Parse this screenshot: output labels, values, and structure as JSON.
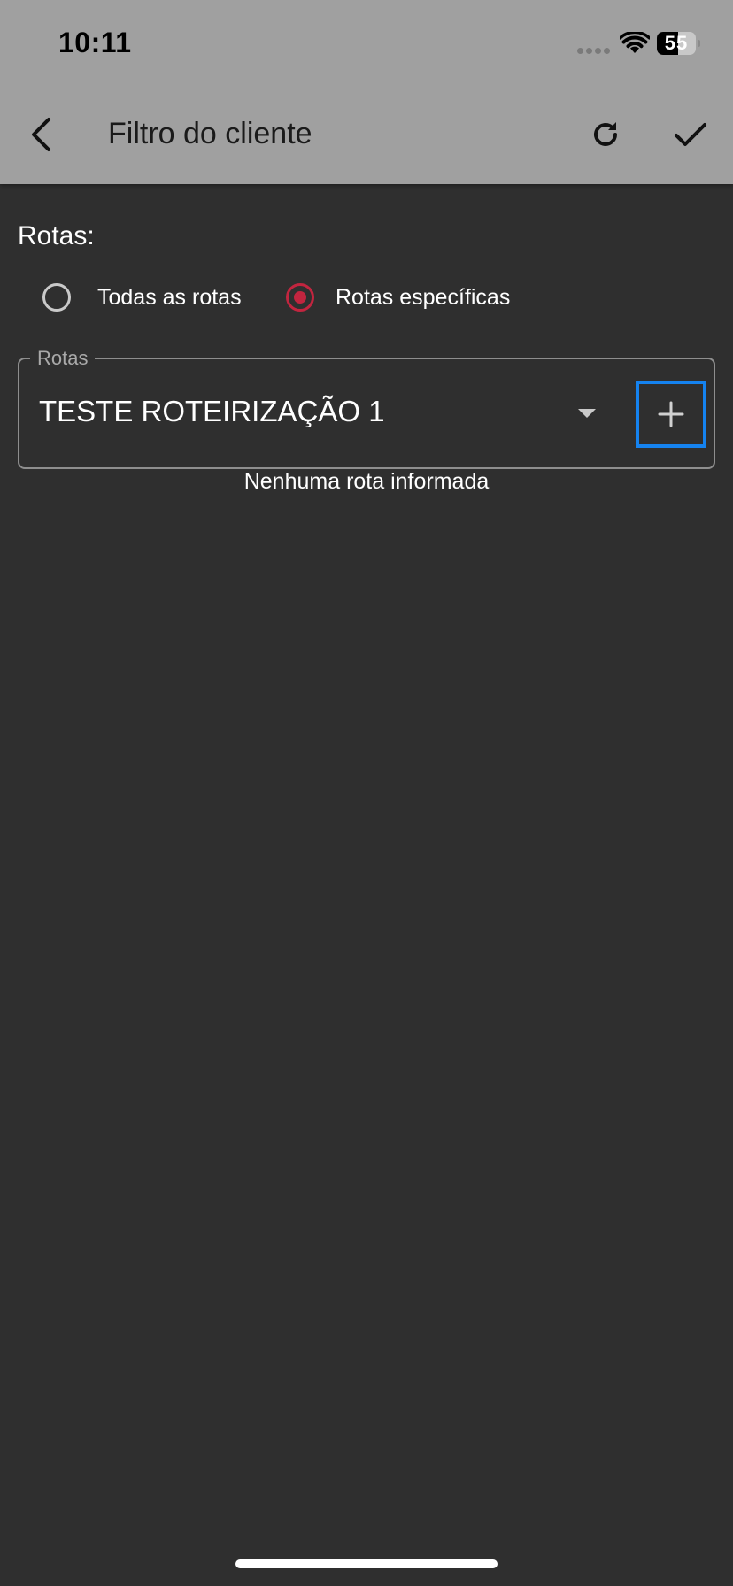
{
  "status_bar": {
    "time": "10:11",
    "battery_level": "55",
    "battery_fraction": 0.55
  },
  "app_bar": {
    "title": "Filtro do cliente",
    "back_icon": "chevron-left-icon",
    "refresh_icon": "refresh-icon",
    "confirm_icon": "check-icon"
  },
  "routes_section": {
    "label": "Rotas:",
    "options": [
      {
        "label": "Todas as rotas",
        "selected": false
      },
      {
        "label": "Rotas específicas",
        "selected": true
      }
    ]
  },
  "route_field": {
    "legend": "Rotas",
    "value": "TESTE ROTEIRIZAÇÃO 1",
    "dropdown_icon": "caret-down-icon",
    "add_icon": "plus-icon",
    "helper_text": "Nenhuma rota informada"
  },
  "colors": {
    "accent": "#c2253f",
    "focus": "#1583f0",
    "background": "#2f2f2f",
    "app_bar": "#a0a0a0"
  }
}
